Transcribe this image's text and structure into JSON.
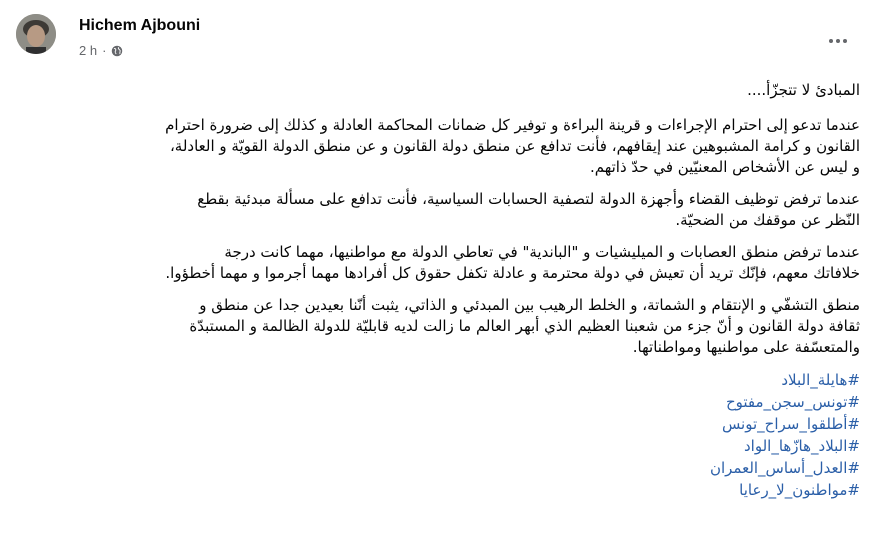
{
  "post": {
    "author": "Hichem Ajbouni",
    "time": "2 h",
    "separator": "·",
    "privacy_icon": "globe-icon",
    "more_icon": "more-options-icon"
  },
  "body": {
    "title": "المبادئ لا تتجزّأ....",
    "paragraphs": [
      {
        "lines": [
          "عندما تدعو إلى احترام الإجراءات و قرينة البراءة و توفير كل ضمانات المحاكمة العادلة و كذلك إلى ضرورة احترام",
          "القانون و كرامة المشبوهين عند إيقافهم، فأنت تدافع عن منطق دولة القانون و عن منطق الدولة القويّة و العادلة،",
          "و ليس عن الأشخاص المعنيّين في حدّ ذاتهم."
        ]
      },
      {
        "lines": [
          "عندما ترفض توظيف القضاء وأجهزة الدولة لتصفية الحسابات السياسية، فأنت تدافع على مسألة مبدئية بقطع",
          "النّظر عن موقفك من الضحيّة."
        ]
      },
      {
        "lines": [
          "عندما ترفض منطق العصابات و الميليشيات و \"الباندية\" في تعاطي الدولة مع مواطنيها، مهما كانت درجة",
          "خلافاتك معهم، فإنّك تريد أن تعيش في دولة محترمة و عادلة تكفل حقوق كل أفرادها مهما أجرموا و مهما أخطؤوا."
        ]
      },
      {
        "lines": [
          "منطق التشفّي و الإنتقام و الشماتة، و الخلط الرهيب بين المبدئي و الذاتي،  يثبت أنّنا بعيدين جدا عن منطق و",
          "ثقافة دولة القانون و أنّ جزء من شعبنا العظيم الذي أبهر العالم ما زالت لديه قابليّة للدولة الظالمة و المستبدّة",
          "والمتعسّفة على مواطنيها ومواطناتها."
        ]
      }
    ],
    "hashtags": [
      "#هايلة_البلاد",
      "#تونس_سجن_مفتوح",
      "#أطلقوا_سراح_تونس",
      "#البلاد_هازّها_الواد",
      "#العدل_أساس_العمران",
      "#مواطنون_لا_رعايا"
    ]
  }
}
